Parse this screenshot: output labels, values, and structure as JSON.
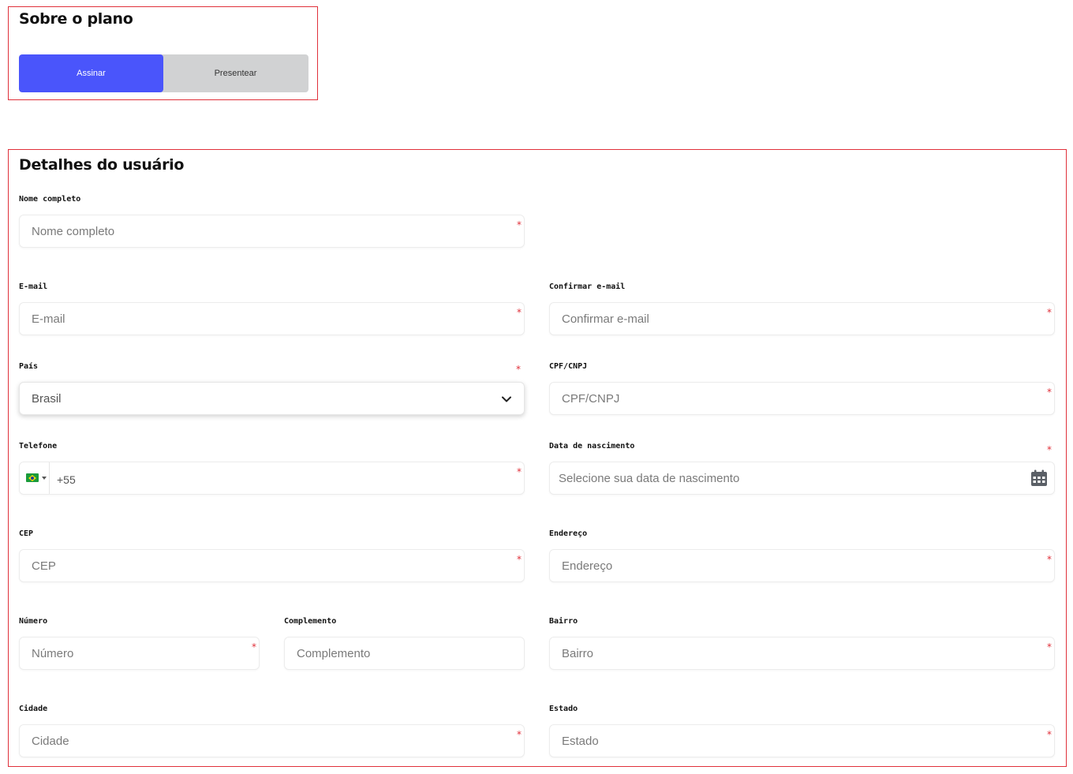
{
  "plan": {
    "title": "Sobre o plano",
    "options": [
      "Assinar",
      "Presentear"
    ],
    "selected": "Assinar"
  },
  "user": {
    "title": "Detalhes do usuário",
    "nome": {
      "label": "Nome completo",
      "placeholder": "Nome completo"
    },
    "email": {
      "label": "E-mail",
      "placeholder": "E-mail"
    },
    "confirmar_email": {
      "label": "Confirmar e-mail",
      "placeholder": "Confirmar e-mail"
    },
    "pais": {
      "label": "País",
      "value": "Brasil"
    },
    "cpf": {
      "label": "CPF/CNPJ",
      "placeholder": "CPF/CNPJ"
    },
    "telefone": {
      "label": "Telefone",
      "value": "+55"
    },
    "nascimento": {
      "label": "Data de nascimento",
      "placeholder": "Selecione sua data de nascimento"
    },
    "cep": {
      "label": "CEP",
      "placeholder": "CEP"
    },
    "endereco": {
      "label": "Endereço",
      "placeholder": "Endereço"
    },
    "numero": {
      "label": "Número",
      "placeholder": "Número"
    },
    "complemento": {
      "label": "Complemento",
      "placeholder": "Complemento"
    },
    "bairro": {
      "label": "Bairro",
      "placeholder": "Bairro"
    },
    "cidade": {
      "label": "Cidade",
      "placeholder": "Cidade"
    },
    "estado": {
      "label": "Estado",
      "placeholder": "Estado"
    },
    "required_mark": "*"
  },
  "colors": {
    "accent": "#4a55fb",
    "toggle_bg": "#d1d2d3",
    "border_highlight": "#e0303a",
    "required": "#e0303a"
  },
  "icons": [
    "chevron-down-icon",
    "brazil-flag-icon",
    "calendar-icon"
  ]
}
